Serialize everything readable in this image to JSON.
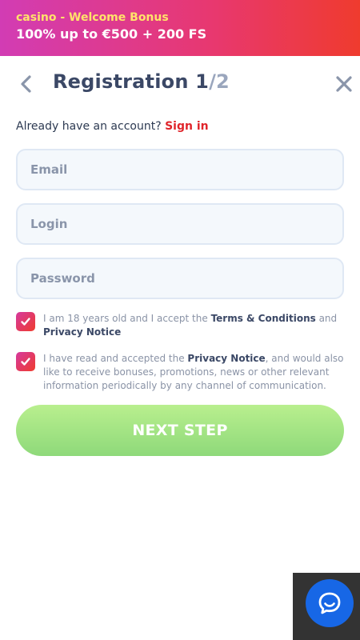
{
  "promo": {
    "brand": "casino",
    "separator": " - ",
    "headline": "Welcome Bonus",
    "offer": "100% up to €500 + 200 FS"
  },
  "header": {
    "title_main": "Registration 1",
    "title_total": "/2",
    "back_icon": "chevron-left-icon",
    "close_icon": "close-icon"
  },
  "signin": {
    "prompt": "Already have an account?",
    "link": "Sign in"
  },
  "form": {
    "email_placeholder": "Email",
    "login_placeholder": "Login",
    "password_placeholder": "Password"
  },
  "consents": [
    {
      "checked": true,
      "prefix": "I am 18 years old and I accept the ",
      "link1": "Terms & Conditions",
      "middle": " and ",
      "link2": "Privacy Notice"
    },
    {
      "checked": true,
      "prefix": "I have read and accepted the ",
      "link1": "Privacy Notice",
      "suffix": ", and would also like to receive bonuses, promotions, news or other relevant information periodically by any channel of communication."
    }
  ],
  "next_button": "NEXT STEP",
  "colors": {
    "accent_red": "#e0252b",
    "promo_yellow": "#ffe36a",
    "button_green": "#8ed97a",
    "chat_blue": "#1767e6"
  },
  "chat": {
    "icon": "chat-bubble-icon"
  }
}
